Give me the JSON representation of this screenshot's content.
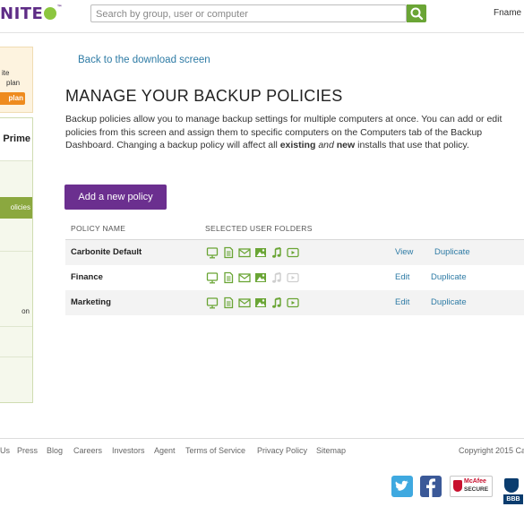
{
  "header": {
    "logo_text": "NITE",
    "logo_tm": "™",
    "search_placeholder": "Search by group, user or computer",
    "user_name": "Fname L"
  },
  "sidebar": {
    "upgrade_line1": "ite",
    "upgrade_line2": "plan",
    "upgrade_button": "plan",
    "plan_title": "Prime",
    "active_item": "olicies",
    "other_item": "on"
  },
  "main": {
    "back_link": "Back to the download screen",
    "title": "MANAGE YOUR BACKUP POLICIES",
    "description": {
      "part1": "Backup policies allow you to manage backup settings for multiple computers at once. You can add or edit policies from this screen and assign them to specific computers on the Computers tab of the Backup Dashboard. Changing a backup policy will affect all ",
      "existing": "existing",
      "and": "and",
      "new": "new",
      "part2": " installs that use that policy."
    },
    "add_button": "Add a new policy",
    "table": {
      "headers": [
        "POLICY NAME",
        "SELECTED USER FOLDERS"
      ],
      "rows": [
        {
          "name": "Carbonite Default",
          "action1": "View",
          "action2": "Duplicate",
          "folders": {
            "desktop": true,
            "documents": true,
            "email": true,
            "pictures": true,
            "music": true,
            "videos": true
          }
        },
        {
          "name": "Finance",
          "action1": "Edit",
          "action2": "Duplicate",
          "folders": {
            "desktop": true,
            "documents": true,
            "email": true,
            "pictures": true,
            "music": false,
            "videos": false
          }
        },
        {
          "name": "Marketing",
          "action1": "Edit",
          "action2": "Duplicate",
          "folders": {
            "desktop": true,
            "documents": true,
            "email": true,
            "pictures": true,
            "music": true,
            "videos": true
          }
        }
      ]
    }
  },
  "footer": {
    "links": [
      "Us",
      "Press",
      "Blog",
      "Careers",
      "Investors",
      "Agent",
      "Terms of Service",
      "Privacy Policy",
      "Sitemap"
    ],
    "copyright": "Copyright 2015 Ca",
    "mcafee_line1": "McAfee",
    "mcafee_line2": "SECURE",
    "bbb_text": "BBB"
  },
  "colors": {
    "accent_purple": "#6b2f8f",
    "icon_green": "#6aa535",
    "icon_disabled": "#cfcfcf",
    "link_blue": "#2e7ba5",
    "upgrade_orange": "#ee8b1e"
  }
}
